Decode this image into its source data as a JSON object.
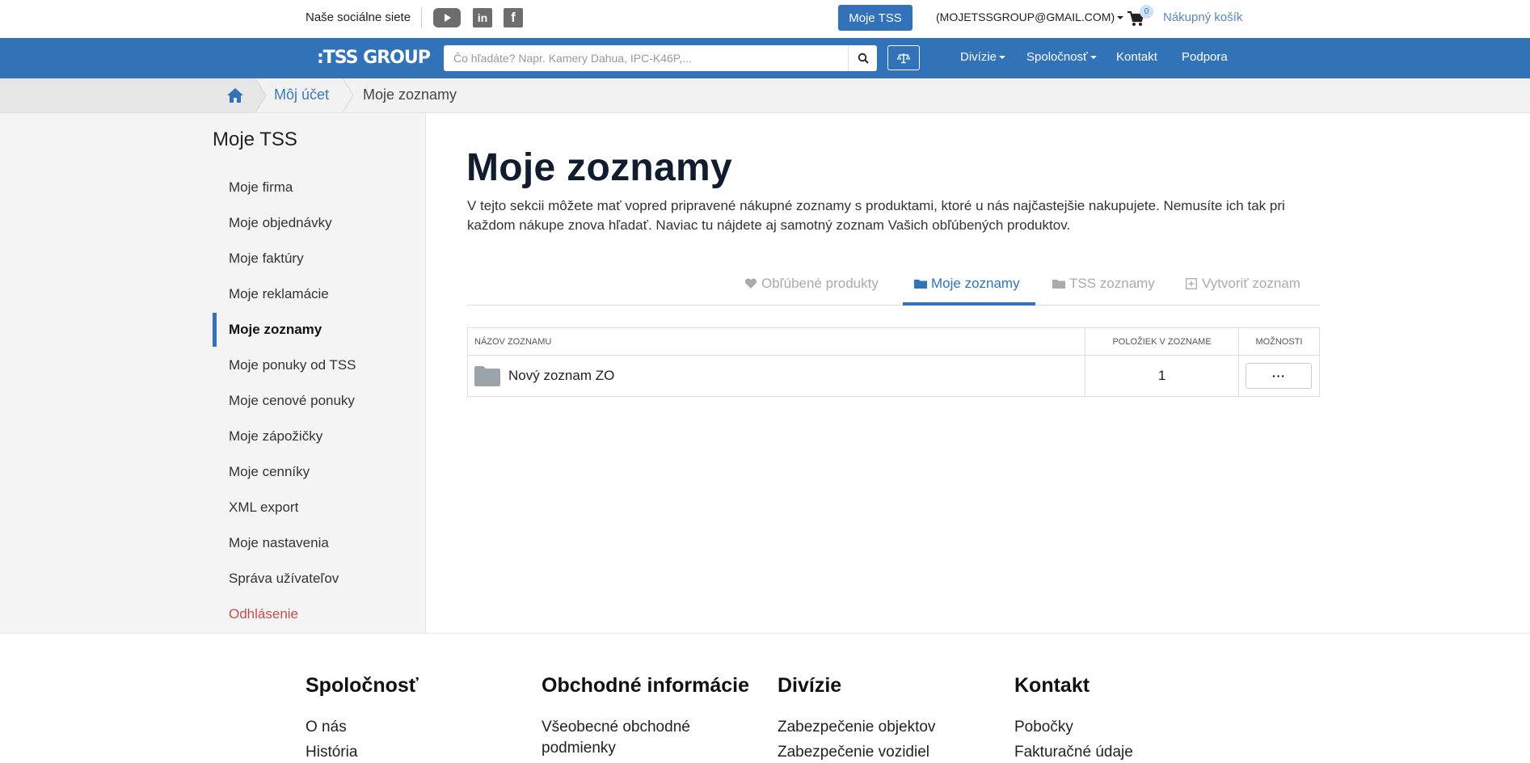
{
  "topbar": {
    "social_label": "Naše sociálne siete",
    "social_icons": [
      "youtube-icon",
      "linkedin-icon",
      "facebook-icon"
    ],
    "my_tss_button": "Moje TSS",
    "account_email": "(MOJETSSGROUP@GMAIL.COM)",
    "cart_count": "0",
    "cart_label": "Nákupný košík"
  },
  "navbar": {
    "logo": ":TSS GROUP",
    "search_placeholder": "Čo hľadáte? Napr. Kamery Dahua, IPC-K46P,...",
    "menu": [
      "Divízie",
      "Spoločnosť",
      "Kontakt",
      "Podpora"
    ]
  },
  "breadcrumb": {
    "link": "Môj účet",
    "current": "Moje zoznamy"
  },
  "sidebar": {
    "title": "Moje TSS",
    "items": [
      "Moje firma",
      "Moje objednávky",
      "Moje faktúry",
      "Moje reklamácie",
      "Moje zoznamy",
      "Moje ponuky od TSS",
      "Moje cenové ponuky",
      "Moje zápožičky",
      "Moje cenníky",
      "XML export",
      "Moje nastavenia",
      "Správa užívateľov",
      "Odhlásenie"
    ],
    "active_item": "Moje zoznamy"
  },
  "main": {
    "title": "Moje zoznamy",
    "description": "V tejto sekcii môžete mať vopred pripravené nákupné zoznamy s produktami, ktoré u nás najčastejšie nakupujete. Nemusíte ich tak pri každom nákupe znova hľadať. Naviac tu nájdete aj samotný zoznam Vašich obľúbených produktov.",
    "tabs": [
      "Obľúbené produkty",
      "Moje zoznamy",
      "TSS zoznamy",
      "Vytvoriť zoznam"
    ],
    "active_tab": "Moje zoznamy",
    "table": {
      "headers": [
        "NÁZOV ZOZNAMU",
        "POLOŽIEK V ZOZNAME",
        "MOŽNOSTI"
      ],
      "rows": [
        {
          "name": "Nový zoznam ZO",
          "count": "1",
          "options": "···"
        }
      ]
    }
  },
  "footer": {
    "columns": [
      {
        "title": "Spoločnosť",
        "links": [
          "O nás",
          "História"
        ]
      },
      {
        "title": "Obchodné informácie",
        "links": [
          "Všeobecné obchodné",
          "podmienky"
        ]
      },
      {
        "title": "Divízie",
        "links": [
          "Zabezpečenie objektov",
          "Zabezpečenie vozidiel"
        ]
      },
      {
        "title": "Kontakt",
        "links": [
          "Pobočky",
          "Fakturačné údaje"
        ]
      }
    ]
  },
  "colors": {
    "brand_blue": "#3272b9",
    "logout_red": "#c0504d",
    "sidebar_bg": "#f4f4f4"
  }
}
